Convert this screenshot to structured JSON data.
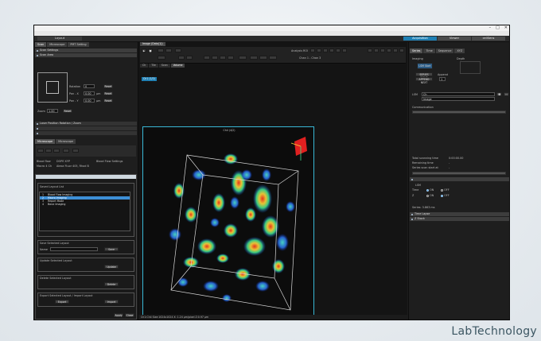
{
  "window": {
    "title": "",
    "controls": [
      "–",
      "□",
      "✕"
    ]
  },
  "menu": [
    "File",
    "Edit",
    "Tools",
    "Windows",
    "Help"
  ],
  "topbar": {
    "layout_label": "Layout",
    "modes": [
      "Acquisition",
      "Viewer",
      "cellSens"
    ],
    "active_mode": "Acquisition"
  },
  "left_panel": {
    "tabs": [
      "Scan",
      "Microscope",
      "PMT Setting"
    ],
    "sections": [
      "Scan Settings",
      "Scan Area",
      "Laser Position Rotation / Zoom"
    ],
    "rotation_label": "Rotation",
    "rotation_value": "0",
    "pan_x_label": "Pan - X",
    "pan_x_value": "0.00",
    "pan_y_label": "Pan - Y",
    "pan_y_value": "0.00",
    "zoom_label": "Zoom",
    "zoom_value": "1.00",
    "unit": "μm",
    "reset_label": "Reset",
    "microscope_tabs": [
      "Microscope",
      "Microscope"
    ],
    "rows": [
      {
        "k": "Blood flow",
        "v": "DOPE XYP"
      },
      {
        "k": "Macro 4 Ch",
        "v": "Alexa Fluor 405, Rhod B"
      }
    ],
    "blood_flow_label": "Blood Flow Settings",
    "dialog": {
      "list_title": "Saved Layout List",
      "list": [
        "Blood Flow Imaging",
        "Macro Imaging",
        "Report Mode",
        "Basic Imaging"
      ],
      "selected": 1,
      "save_title": "Save Selected Layout",
      "name_label": "Name",
      "save_btn": "Save",
      "update_title": "Update Selected Layout",
      "update_btn": "Update",
      "delete_title": "Delete Selected Layout",
      "delete_btn": "Delete",
      "export_title": "Export Selected Layout / Import Layout",
      "export_btn": "Export",
      "import_btn": "Import",
      "apply_btn": "Apply",
      "close_btn": "Close"
    }
  },
  "center": {
    "tab": "Image (Data(1))",
    "analysis_label": "Analysis ROI",
    "channel_label": "Chan 1 - Chan 3",
    "subtabs": [
      "Ch",
      "Tile",
      "Scan",
      "Volume"
    ],
    "active_subtab": "Volume",
    "image_tag": "Ch1 (1/2)",
    "view_title": "Ch4 (4/2)",
    "status": "Ch1:Ch4 Size:1024x1024  X: 1.24 μm/pixel  Z:0.97 μm"
  },
  "right_panel": {
    "tabs": [
      "Series",
      "Time",
      "Sequence",
      "XYZ"
    ],
    "imaging_label": "Imaging",
    "depth_label": "Depth",
    "lsm_start": "LSM Start",
    "series_done": "SERIES DONE",
    "append_label": "Append",
    "append_value": "1",
    "append_next": "APPEND NEXT",
    "lsm_label": "LSM",
    "lsm_value": "Ch",
    "lsm_type": "Image",
    "comm_label": "Communication",
    "total_time_label": "Total scanning time",
    "total_time_value": "0:00:00.00",
    "remain_label": "Remaining time",
    "remain_value": "-",
    "start_label": "Series scan start at",
    "start_value": "-",
    "lsm2_label": "LSM",
    "time_label": "Time",
    "z_label": "Z",
    "on": "ON",
    "off": "OFF",
    "series_label": "Series: 3.863 ms",
    "sections": [
      "Time Lapse",
      "Z Stack"
    ]
  },
  "brand": "LabTechnology",
  "colors": {
    "accent": "#1f7fb3",
    "viewport_border": "#39b8d6",
    "marker": "#e02020"
  }
}
